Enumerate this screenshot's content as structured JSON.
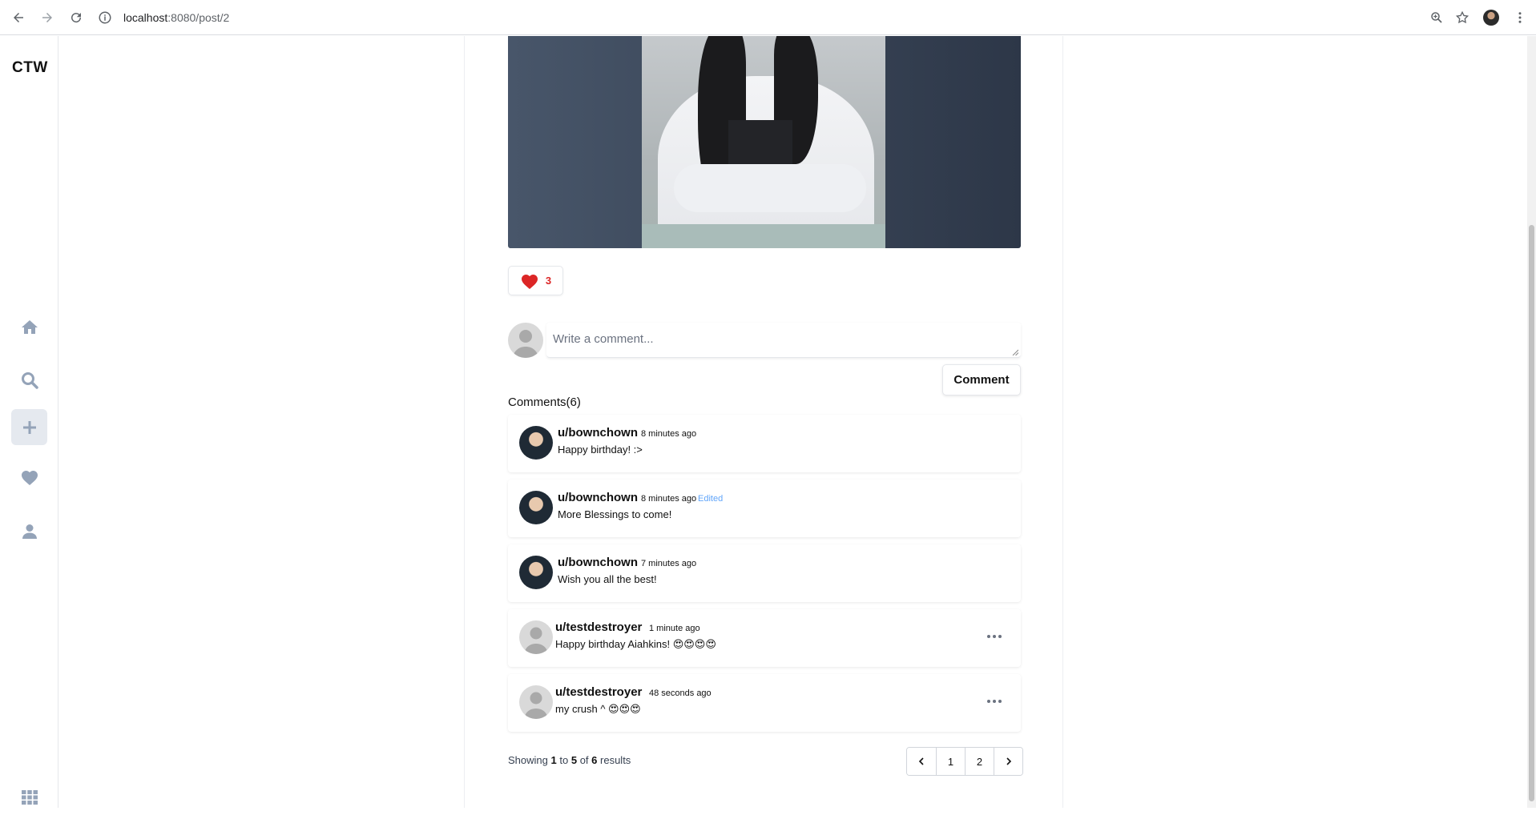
{
  "browser": {
    "url_host": "localhost",
    "url_path": ":8080/post/2"
  },
  "app": {
    "logo": "CTW"
  },
  "sidebar": {
    "items": [
      {
        "name": "home",
        "icon": "home-icon"
      },
      {
        "name": "search",
        "icon": "search-icon"
      },
      {
        "name": "create",
        "icon": "plus-icon",
        "active": true
      },
      {
        "name": "liked",
        "icon": "heart-icon"
      },
      {
        "name": "profile",
        "icon": "user-icon"
      },
      {
        "name": "apps",
        "icon": "grid-icon"
      }
    ]
  },
  "post": {
    "likes": "3"
  },
  "comment_form": {
    "placeholder": "Write a comment...",
    "submit_label": "Comment"
  },
  "comments": {
    "title": "Comments(6)",
    "items": [
      {
        "user": "u/bownchown",
        "time": "8 minutes ago",
        "edited": "",
        "text": "Happy birthday! :>"
      },
      {
        "user": "u/bownchown",
        "time": "8 minutes ago",
        "edited": "Edited",
        "text": "More Blessings to come!"
      },
      {
        "user": "u/bownchown",
        "time": "7 minutes ago",
        "edited": "",
        "text": "Wish you all the best!"
      },
      {
        "user": "u/testdestroyer",
        "time": "1 minute ago",
        "edited": "",
        "text": "Happy birthday Aiahkins! 😍😍😍😍"
      },
      {
        "user": "u/testdestroyer",
        "time": "48 seconds ago",
        "edited": "",
        "text": "my crush ^ 😍😍😍"
      }
    ]
  },
  "pagination": {
    "showing_prefix": "Showing",
    "from": "1",
    "to_word": "to",
    "to": "5",
    "of_word": "of",
    "total": "6",
    "suffix": "results",
    "pages": [
      "1",
      "2"
    ]
  }
}
